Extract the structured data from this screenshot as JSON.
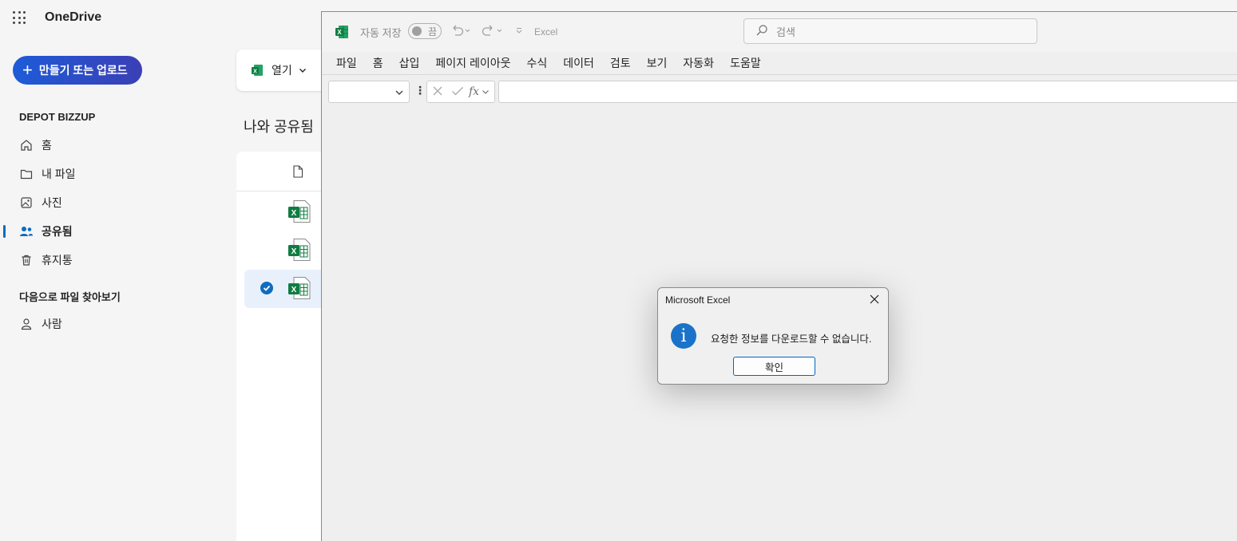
{
  "onedrive": {
    "brand": "OneDrive",
    "create_button": "만들기 또는 업로드",
    "org_name": "DEPOT BIZZUP",
    "nav": [
      {
        "label": "홈",
        "icon": "home-icon"
      },
      {
        "label": "내 파일",
        "icon": "folder-icon"
      },
      {
        "label": "사진",
        "icon": "image-icon"
      },
      {
        "label": "공유됨",
        "icon": "people-icon",
        "active": true
      },
      {
        "label": "휴지통",
        "icon": "trash-icon"
      }
    ],
    "browse_section": "다음으로 파일 찾아보기",
    "browse_items": [
      {
        "label": "사람",
        "icon": "person-icon"
      }
    ],
    "open_button": "열기",
    "shared_title": "나와 공유됨"
  },
  "excel": {
    "autosave_label": "자동 저장",
    "autosave_state": "끔",
    "app_name": "Excel",
    "search_placeholder": "검색",
    "menu": [
      "파일",
      "홈",
      "삽입",
      "페이지 레이아웃",
      "수식",
      "데이터",
      "검토",
      "보기",
      "자동화",
      "도움말"
    ],
    "fx_label": "fx"
  },
  "dialog": {
    "title": "Microsoft Excel",
    "message": "요청한 정보를 다운로드할 수 없습니다.",
    "ok_label": "확인"
  },
  "colors": {
    "accent": "#0f6cbd",
    "excel_green": "#107c41",
    "create_gradient_start": "#1e5bd8",
    "create_gradient_end": "#3b3fb5"
  }
}
